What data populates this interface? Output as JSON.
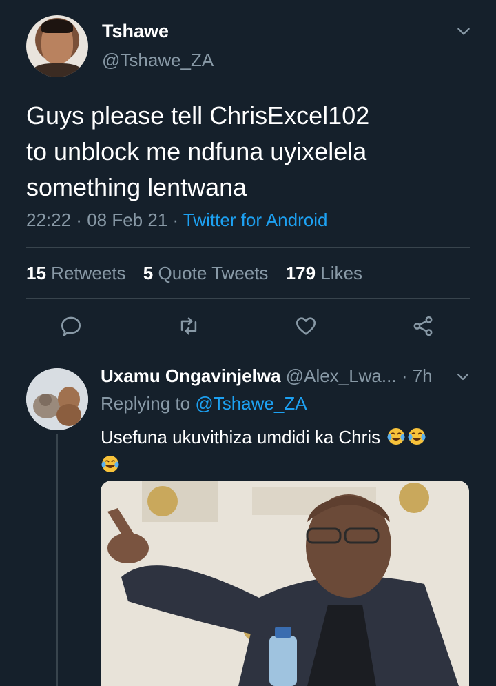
{
  "tweet": {
    "author_name": "Tshawe",
    "author_handle": "@Tshawe_ZA",
    "text": "Guys please tell ChrisExcel102\nto unblock me ndfuna uyixelela\nsomething lentwana",
    "time": "22:22",
    "date": "08 Feb 21",
    "source": "Twitter for Android",
    "stats": {
      "retweets_count": "15",
      "retweets_label": "Retweets",
      "quotes_count": "5",
      "quotes_label": "Quote Tweets",
      "likes_count": "179",
      "likes_label": "Likes"
    }
  },
  "reply": {
    "author_name": "Uxamu Ongavinjelwa",
    "author_handle": "@Alex_Lwa...",
    "age": "7h",
    "replying_prefix": "Replying to",
    "replying_handle": "@Tshawe_ZA",
    "text": "Usefuna ukuvithiza umdidi ka Chris"
  },
  "icons": {
    "reply": "comment-icon",
    "retweet": "retweet-icon",
    "like": "heart-icon",
    "share": "share-icon",
    "menu": "chevron-down-icon",
    "emoji": "face-with-tears-of-joy-emoji"
  },
  "colors": {
    "background": "#15202b",
    "text": "#ffffff",
    "muted": "#8899a6",
    "link": "#1da1f2",
    "divider": "#38444d"
  }
}
